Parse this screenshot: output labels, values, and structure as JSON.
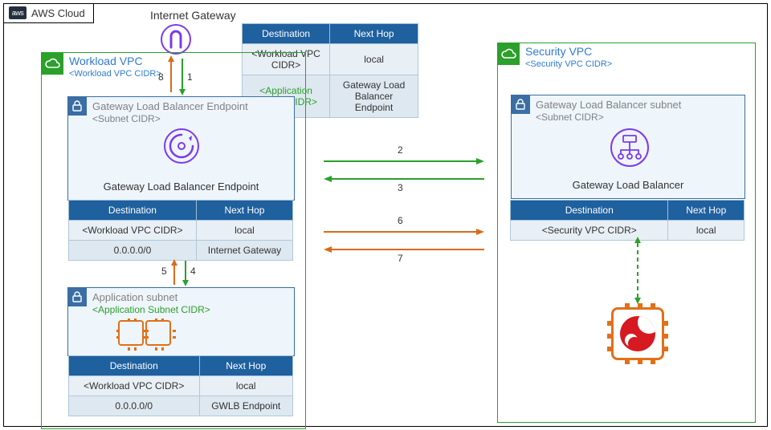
{
  "header": {
    "aws_cloud": "AWS Cloud",
    "igw": "Internet Gateway"
  },
  "workload_vpc": {
    "title": "Workload  VPC",
    "cidr": "<Workload VPC CIDR>"
  },
  "security_vpc": {
    "title": "Security VPC",
    "cidr": "<Security VPC CIDR>"
  },
  "glbe_subnet": {
    "title": "Gateway Load Balancer Endpoint",
    "cidr": "<Subnet CIDR>",
    "caption": "Gateway Load Balancer Endpoint"
  },
  "app_subnet": {
    "title": "Application subnet",
    "cidr": "<Application Subnet CIDR>"
  },
  "glb_subnet": {
    "title": "Gateway Load Balancer subnet",
    "cidr": "<Subnet CIDR>",
    "caption": "Gateway Load Balancer"
  },
  "rt_headers": {
    "dest": "Destination",
    "next": "Next Hop"
  },
  "rt_igw": {
    "r1d": "<Workload VPC CIDR>",
    "r1n": "local",
    "r2d": "<Application Subnet CIDR>",
    "r2n": "Gateway Load Balancer Endpoint"
  },
  "rt_glbe": {
    "r1d": "<Workload VPC CIDR>",
    "r1n": "local",
    "r2d": "0.0.0.0/0",
    "r2n": "Internet Gateway"
  },
  "rt_app": {
    "r1d": "<Workload VPC CIDR>",
    "r1n": "local",
    "r2d": "0.0.0.0/0",
    "r2n": "GWLB Endpoint"
  },
  "rt_sec": {
    "r1d": "<Security VPC CIDR>",
    "r1n": "local"
  },
  "steps": {
    "s1": "1",
    "s2": "2",
    "s3": "3",
    "s4": "4",
    "s5": "5",
    "s6": "6",
    "s7": "7",
    "s8": "8"
  }
}
